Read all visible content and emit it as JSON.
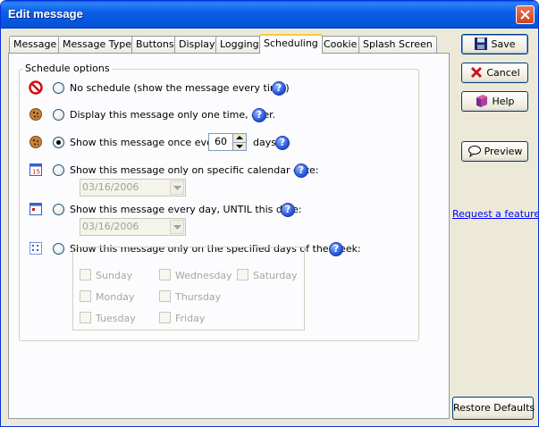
{
  "window": {
    "title": "Edit message"
  },
  "tabs": [
    {
      "label": "Message"
    },
    {
      "label": "Message Type"
    },
    {
      "label": "Buttons"
    },
    {
      "label": "Display"
    },
    {
      "label": "Logging"
    },
    {
      "label": "Scheduling",
      "active": true
    },
    {
      "label": "Cookie"
    },
    {
      "label": "Splash Screen"
    }
  ],
  "schedule": {
    "group_label": "Schedule options",
    "options": [
      {
        "label": "No schedule (show the message every time)",
        "icon": "no-entry-icon"
      },
      {
        "label": "Display this message only one time, ever.",
        "icon": "cookie-icon"
      },
      {
        "label_before": "Show this message once every",
        "value": "60",
        "label_after": "days",
        "icon": "cookie-icon",
        "checked": true
      },
      {
        "label": "Show this message only on specific calendar date:",
        "date": "03/16/2006",
        "icon": "calendar-icon"
      },
      {
        "label": "Show this message every day, UNTIL this date:",
        "date": "03/16/2006",
        "icon": "calendar-until-icon"
      },
      {
        "label": "Show this message only on the specified days of the week:",
        "icon": "calendar-week-icon"
      }
    ],
    "days": [
      "Sunday",
      "Wednesday",
      "Saturday",
      "Monday",
      "Thursday",
      "Tuesday",
      "Friday"
    ]
  },
  "buttons": {
    "save": "Save",
    "cancel": "Cancel",
    "help": "Help",
    "preview": "Preview",
    "request": "Request a feature",
    "restore": "Restore Defaults"
  },
  "colors": {
    "title_bar": "#0a5ee6",
    "dialog_bg": "#ece9d8",
    "link": "#0000ff"
  }
}
